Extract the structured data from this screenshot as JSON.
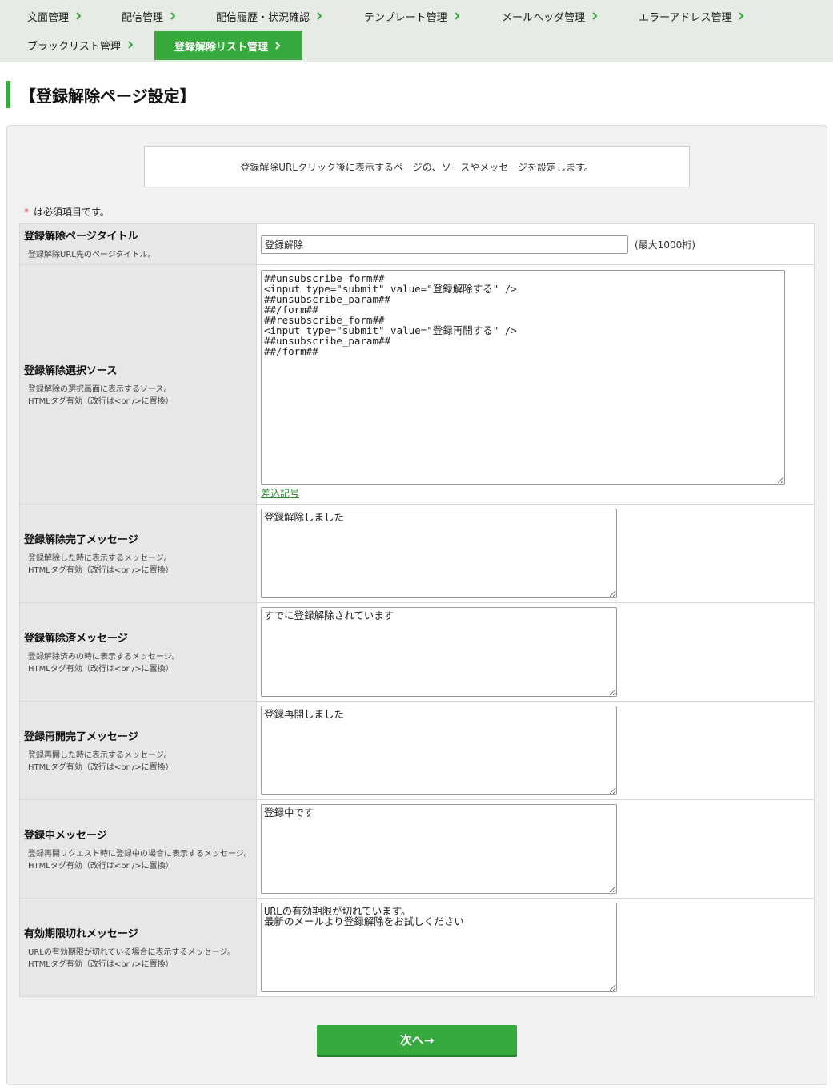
{
  "nav": {
    "items": [
      {
        "label": "文面管理"
      },
      {
        "label": "配信管理"
      },
      {
        "label": "配信履歴・状況確認"
      },
      {
        "label": "テンプレート管理"
      },
      {
        "label": "メールヘッダ管理"
      },
      {
        "label": "エラーアドレス管理"
      },
      {
        "label": "ブラックリスト管理"
      },
      {
        "label": "登録解除リスト管理",
        "active": true
      }
    ]
  },
  "page": {
    "title": "【登録解除ページ設定】",
    "intro": "登録解除URLクリック後に表示するページの、ソースやメッセージを設定します。",
    "required_star": "*",
    "required_note": "は必須項目です。"
  },
  "form": {
    "page_title": {
      "label": "登録解除ページタイトル",
      "desc": "登録解除URL先のページタイトル。",
      "value": "登録解除",
      "hint": "(最大1000桁)"
    },
    "select_source": {
      "label": "登録解除選択ソース",
      "desc1": "登録解除の選択画面に表示するソース。",
      "desc2": "HTMLタグ有効（改行は<br />に置換）",
      "value": "##unsubscribe_form##\n<input type=\"submit\" value=\"登録解除する\" />\n##unsubscribe_param##\n##/form##\n##resubscribe_form##\n<input type=\"submit\" value=\"登録再開する\" />\n##unsubscribe_param##\n##/form##",
      "link": "差込記号"
    },
    "done_message": {
      "label": "登録解除完了メッセージ",
      "desc1": "登録解除した時に表示するメッセージ。",
      "desc2": "HTMLタグ有効（改行は<br />に置換）",
      "value": "登録解除しました"
    },
    "already_message": {
      "label": "登録解除済メッセージ",
      "desc1": "登録解除済みの時に表示するメッセージ。",
      "desc2": "HTMLタグ有効（改行は<br />に置換）",
      "value": "すでに登録解除されています"
    },
    "resume_message": {
      "label": "登録再開完了メッセージ",
      "desc1": "登録再開した時に表示するメッセージ。",
      "desc2": "HTMLタグ有効（改行は<br />に置換）",
      "value": "登録再開しました"
    },
    "registered_message": {
      "label": "登録中メッセージ",
      "desc1": "登録再開リクエスト時に登録中の場合に表示するメッセージ。",
      "desc2": "HTMLタグ有効（改行は<br />に置換）",
      "value": "登録中です"
    },
    "expired_message": {
      "label": "有効期限切れメッセージ",
      "desc1": "URLの有効期限が切れている場合に表示するメッセージ。",
      "desc2": "HTMLタグ有効（改行は<br />に置換）",
      "value": "URLの有効期限が切れています。\n最新のメールより登録解除をお試しください"
    }
  },
  "actions": {
    "next_label": "次へ→"
  },
  "colors": {
    "accent": "#36aa3c",
    "nav_bg": "#e6ebe5",
    "label_bg": "#e6e8e5",
    "required": "#dd2222"
  }
}
